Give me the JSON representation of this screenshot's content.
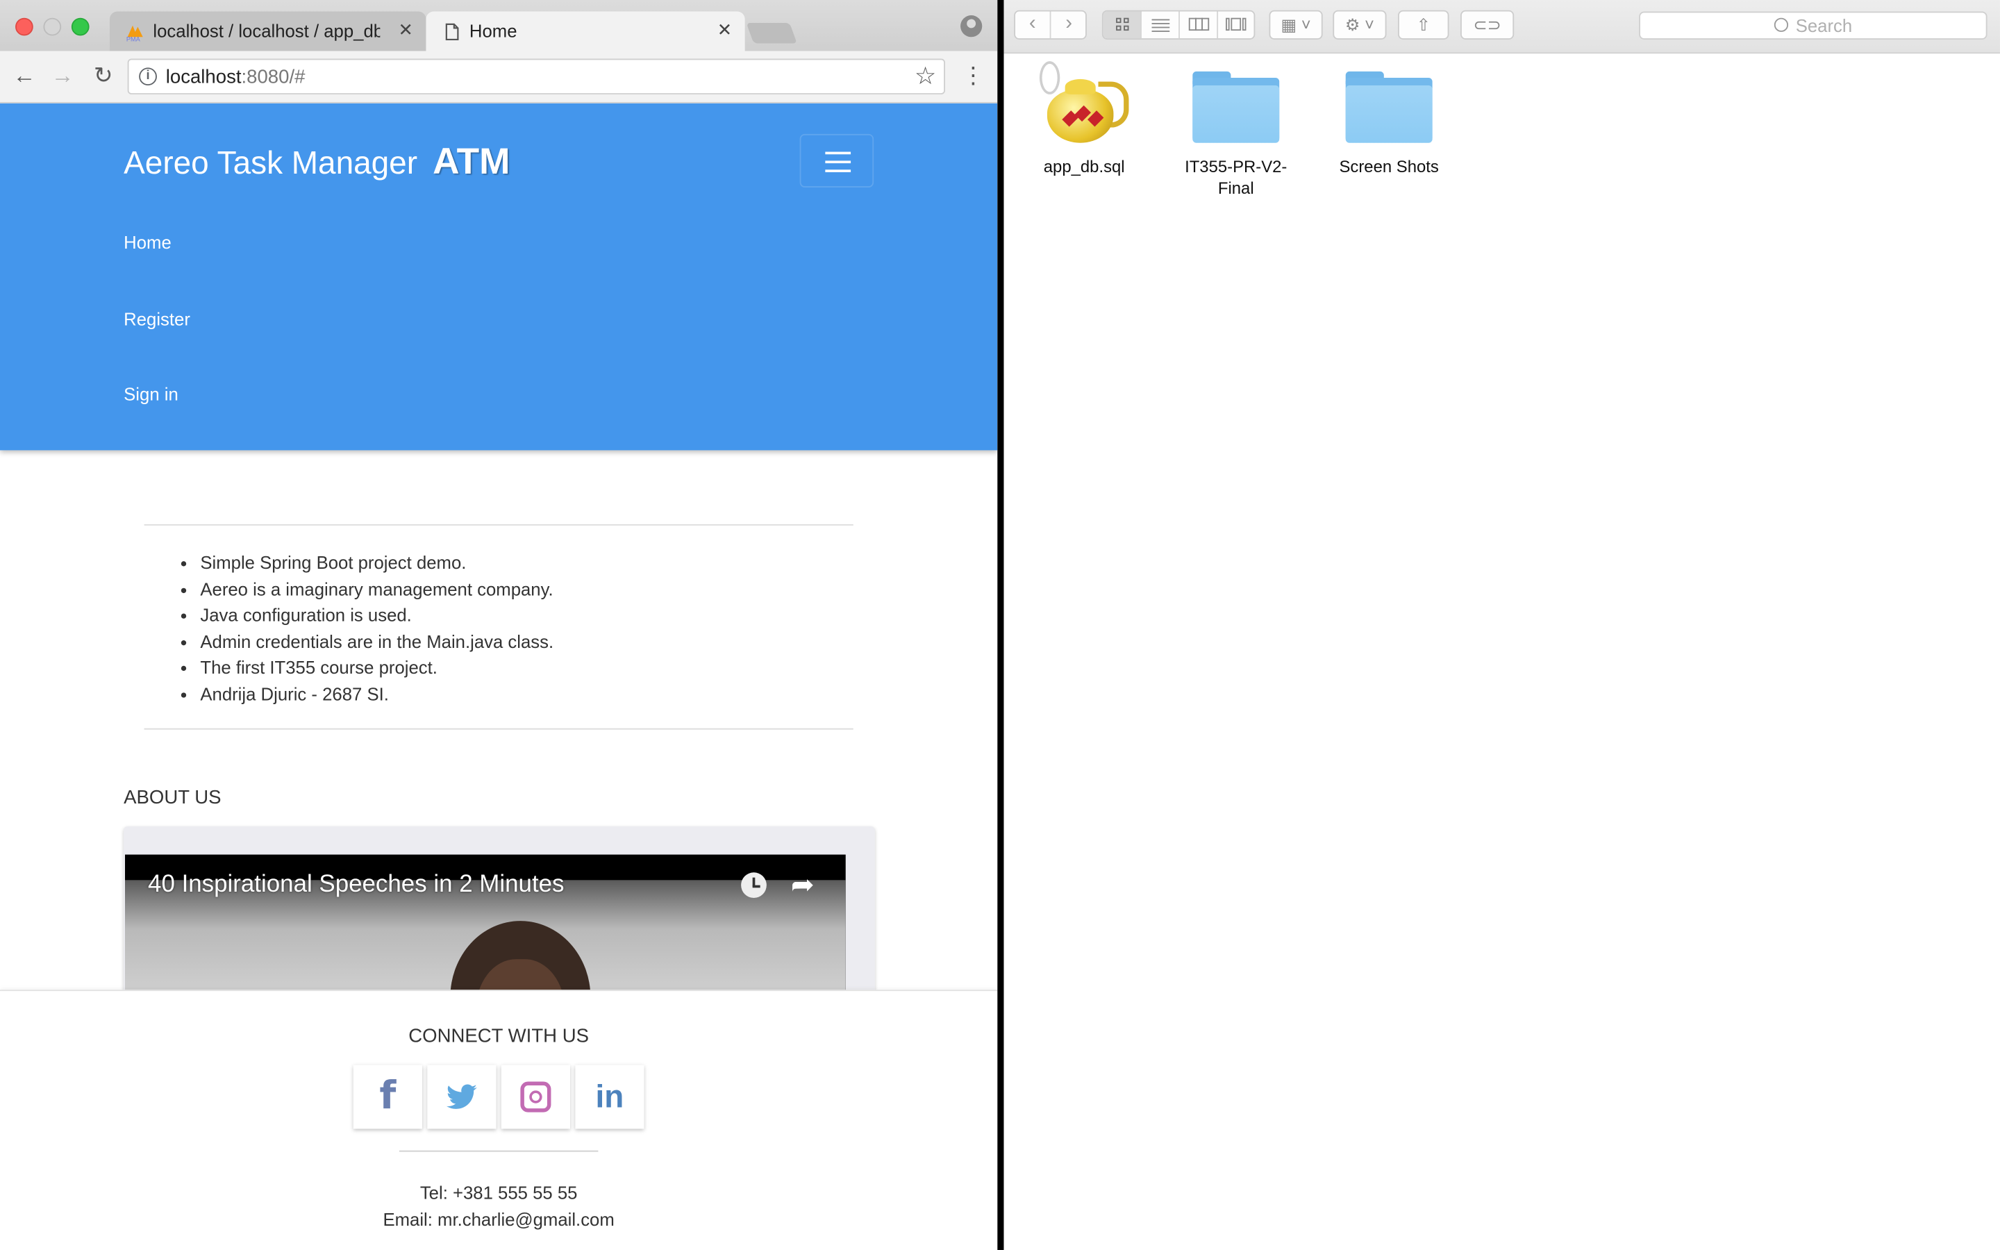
{
  "browser": {
    "tabs": [
      {
        "label": "localhost / localhost / app_db |",
        "favicon": "phpmyadmin-icon"
      },
      {
        "label": "Home",
        "favicon": "page-icon"
      }
    ],
    "url_host": "localhost",
    "url_rest": ":8080/#"
  },
  "site": {
    "brand_name": "Aereo Task Manager",
    "brand_abbr": "ATM",
    "nav": [
      "Home",
      "Register",
      "Sign in"
    ],
    "features": [
      "Simple Spring Boot project demo.",
      "Aereo is a imaginary management company.",
      "Java configuration is used.",
      "Admin credentials are in the Main.java class.",
      "The first IT355 course project.",
      "Andrija Djuric - 2687 SI."
    ],
    "about_title": "ABOUT US",
    "video_title": "40 Inspirational Speeches in 2 Minutes",
    "footer": {
      "connect_title": "CONNECT WITH US",
      "social": [
        "facebook-icon",
        "twitter-icon",
        "instagram-icon",
        "linkedin-icon"
      ],
      "tel": "Tel: +381 555 55 55",
      "email": "Email: mr.charlie@gmail.com"
    },
    "colors": {
      "hero": "#4496ec"
    }
  },
  "finder": {
    "search_placeholder": "Search",
    "items": [
      {
        "label": "app_db.sql",
        "icon": "sql-lamp-icon"
      },
      {
        "label": "IT355-PR-V2-Final",
        "icon": "folder-icon"
      },
      {
        "label": "Screen Shots",
        "icon": "folder-icon"
      }
    ]
  }
}
